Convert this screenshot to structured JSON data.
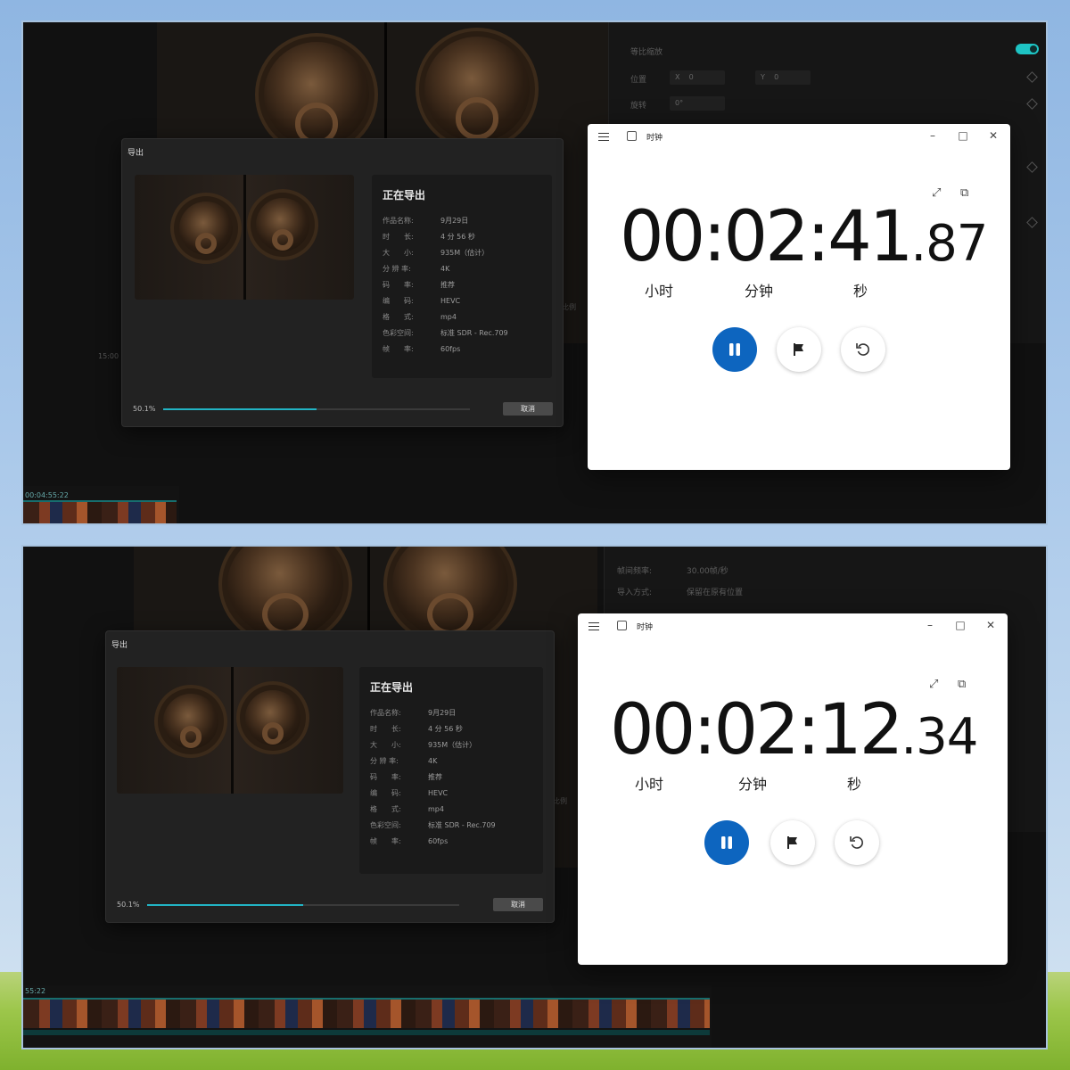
{
  "screens": [
    {
      "editor": {
        "right_panel": {
          "rows": [
            "等比缩放",
            "位置",
            "旋转"
          ],
          "fields": [
            "X",
            "0",
            "Y",
            "0",
            "0°"
          ]
        },
        "side_tag": "比例",
        "timeline_timecode": "00:04:55:22",
        "ruler_mark": "15:00"
      },
      "export_dialog": {
        "title": "导出",
        "heading": "正在导出",
        "info": [
          {
            "key": "作品名称:",
            "value": "9月29日"
          },
          {
            "key": "时　　长:",
            "value": "4 分 56 秒"
          },
          {
            "key": "大　　小:",
            "value": "935M（估计）"
          },
          {
            "key": "分 辨 率:",
            "value": "4K"
          },
          {
            "key": "码　　率:",
            "value": "推荐"
          },
          {
            "key": "编　　码:",
            "value": "HEVC"
          },
          {
            "key": "格　　式:",
            "value": "mp4"
          },
          {
            "key": "色彩空间:",
            "value": "标准 SDR - Rec.709"
          },
          {
            "key": "帧　　率:",
            "value": "60fps"
          }
        ],
        "progress_label": "50.1%",
        "progress": 0.501,
        "cancel_label": "取消"
      },
      "clock": {
        "app_title": "时钟",
        "time_main": "00:02:41",
        "time_frac": ".87",
        "units": [
          "小时",
          "分钟",
          "秒"
        ],
        "accent": "#0d65bf"
      }
    },
    {
      "editor": {
        "right_panel": {
          "rows": [
            "帧间频率:",
            "导入方式:"
          ],
          "values": [
            "30.00帧/秒",
            "保留在原有位置"
          ]
        },
        "side_tag": "比例",
        "timeline_timecode": "55:22"
      },
      "export_dialog": {
        "title": "导出",
        "heading": "正在导出",
        "info": [
          {
            "key": "作品名称:",
            "value": "9月29日"
          },
          {
            "key": "时　　长:",
            "value": "4 分 56 秒"
          },
          {
            "key": "大　　小:",
            "value": "935M（估计）"
          },
          {
            "key": "分 辨 率:",
            "value": "4K"
          },
          {
            "key": "码　　率:",
            "value": "推荐"
          },
          {
            "key": "编　　码:",
            "value": "HEVC"
          },
          {
            "key": "格　　式:",
            "value": "mp4"
          },
          {
            "key": "色彩空间:",
            "value": "标准 SDR - Rec.709"
          },
          {
            "key": "帧　　率:",
            "value": "60fps"
          }
        ],
        "progress_label": "50.1%",
        "progress": 0.501,
        "cancel_label": "取消"
      },
      "clock": {
        "app_title": "时钟",
        "time_main": "00:02:12",
        "time_frac": ".34",
        "units": [
          "小时",
          "分钟",
          "秒"
        ],
        "accent": "#0d65bf"
      }
    }
  ]
}
